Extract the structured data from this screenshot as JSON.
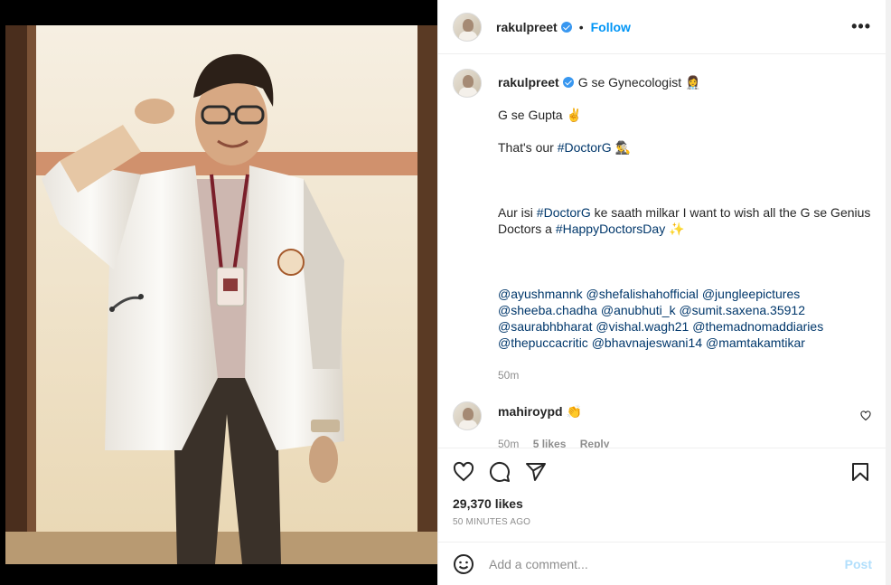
{
  "header": {
    "username": "rakulpreet",
    "separator": "•",
    "follow_label": "Follow",
    "more_label": "•••"
  },
  "caption": {
    "username": "rakulpreet",
    "line1": "G se Gynecologist 👩‍⚕️",
    "line2": "G se Gupta ✌️",
    "line3_prefix": "That's our ",
    "line3_tag": "#DoctorG",
    "line3_suffix": " 🕵️‍♂️",
    "line4_a": "Aur isi ",
    "line4_tag": "#DoctorG",
    "line4_b": " ke saath milkar I want to wish all the G se Genius Doctors a ",
    "line4_tag2": "#HappyDoctorsDay",
    "line4_c": " ✨",
    "mentions": [
      "@ayushmannk",
      "@shefalishahofficial",
      "@jungleepictures",
      "@sheeba.chadha",
      "@anubhuti_k",
      "@sumit.saxena.35912",
      "@saurabhbharat",
      "@vishal.wagh21",
      "@themadnomaddiaries",
      "@thepuccacritic",
      "@bhavnajeswani14",
      "@mamtakamtikar"
    ],
    "time": "50m"
  },
  "comment": {
    "username": "mahiroypd",
    "text": "👏",
    "time": "50m",
    "likes": "5 likes",
    "reply": "Reply"
  },
  "actions": {
    "icons": [
      "heart-icon",
      "comment-icon",
      "share-icon",
      "bookmark-icon"
    ]
  },
  "likes_text": "29,370 likes",
  "posted_ago": "50 MINUTES AGO",
  "add_comment": {
    "placeholder": "Add a comment...",
    "post_label": "Post"
  },
  "colors": {
    "accent": "#0095f6",
    "post_disabled": "#b2dffc",
    "hashtag": "#00376b",
    "muted": "#8e8e8e"
  }
}
